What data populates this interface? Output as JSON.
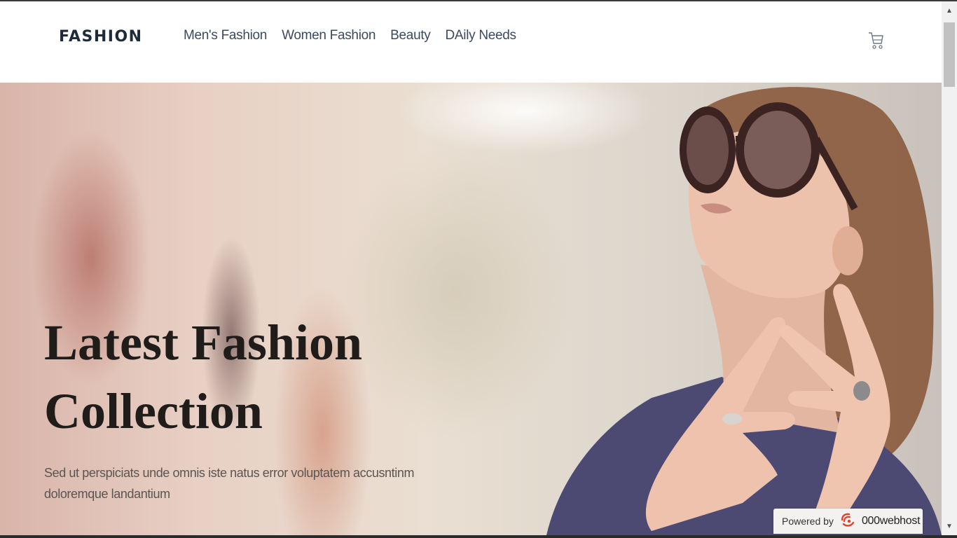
{
  "header": {
    "brand": "FASHION",
    "nav": [
      {
        "label": "Men's Fashion"
      },
      {
        "label": "Women Fashion"
      },
      {
        "label": "Beauty"
      },
      {
        "label": "DAily Needs"
      }
    ],
    "cart_icon": "cart-icon"
  },
  "hero": {
    "title_line1": "Latest Fashion",
    "title_line2": "Collection",
    "description_line1": "Sed ut perspiciats unde omnis iste natus error voluptatem accusntinm",
    "description_line2": "doloremque landantium"
  },
  "badge": {
    "powered_by": "Powered by",
    "brand": "000webhost",
    "logo_icon": "webhost-logo-icon"
  },
  "colors": {
    "brand_text": "#1d2b3a",
    "nav_text": "#3b4a5e",
    "title_text": "#1f1c1a"
  }
}
